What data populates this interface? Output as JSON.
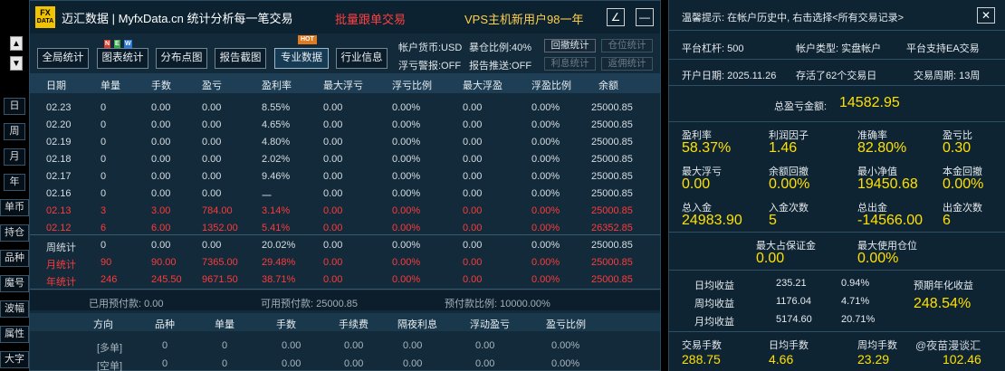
{
  "sidebar": {
    "up": "▲",
    "down": "▼",
    "periods": [
      "日",
      "周",
      "月",
      "年"
    ],
    "tools": [
      "单币",
      "持仓",
      "品种",
      "魔号",
      "波幅",
      "属性",
      "大字"
    ]
  },
  "header": {
    "logo_top": "FX",
    "logo_bottom": "DATA",
    "title": "迈汇数据 | MyfxData.cn  统计分析每一笔交易",
    "promo1": "批量跟单交易",
    "promo2": "VPS主机新用户98一年",
    "edit_icon": "∠",
    "min_icon": "—"
  },
  "toolbar": {
    "buttons": [
      "全局统计",
      "图表统计",
      "分布点图",
      "报告截图",
      "专业数据",
      "行业信息"
    ],
    "new_badge": "NEW",
    "hot_badge": "HOT",
    "info": {
      "currency": "帐户货币:USD",
      "exposure": "暴仓比例:40%",
      "float_alert": "浮亏警报:OFF",
      "report": "报告推送:OFF"
    },
    "small": [
      "回撤统计",
      "仓位统计",
      "利息统计",
      "返佣统计"
    ]
  },
  "grid": {
    "headers": [
      "日期",
      "单量",
      "手数",
      "盈亏",
      "盈利率",
      "最大浮亏",
      "浮亏比例",
      "最大浮盈",
      "浮盈比例",
      "余额"
    ],
    "rows": [
      {
        "c": [
          "02.23",
          "0",
          "0.00",
          "0.00",
          "8.55%",
          "0.00",
          "0.00%",
          "0.00",
          "0.00%",
          "25000.85"
        ],
        "red": false
      },
      {
        "c": [
          "02.20",
          "0",
          "0.00",
          "0.00",
          "4.65%",
          "0.00",
          "0.00%",
          "0.00",
          "0.00%",
          "25000.85"
        ],
        "red": false
      },
      {
        "c": [
          "02.19",
          "0",
          "0.00",
          "0.00",
          "4.80%",
          "0.00",
          "0.00%",
          "0.00",
          "0.00%",
          "25000.85"
        ],
        "red": false
      },
      {
        "c": [
          "02.18",
          "0",
          "0.00",
          "0.00",
          "2.02%",
          "0.00",
          "0.00%",
          "0.00",
          "0.00%",
          "25000.85"
        ],
        "red": false
      },
      {
        "c": [
          "02.17",
          "0",
          "0.00",
          "0.00",
          "9.46%",
          "0.00",
          "0.00%",
          "0.00",
          "0.00%",
          "25000.85"
        ],
        "red": false
      },
      {
        "c": [
          "02.16",
          "0",
          "0.00",
          "0.00",
          "一",
          "0.00",
          "0.00%",
          "0.00",
          "0.00%",
          "25000.85"
        ],
        "red": false
      },
      {
        "c": [
          "02.13",
          "3",
          "3.00",
          "784.00",
          "3.14%",
          "0.00",
          "0.00%",
          "0.00",
          "0.00%",
          "25000.85"
        ],
        "red": true
      },
      {
        "c": [
          "02.12",
          "6",
          "6.00",
          "1352.00",
          "5.41%",
          "0.00",
          "0.00%",
          "0.00",
          "0.00%",
          "26352.85"
        ],
        "red": true
      }
    ],
    "stats": [
      {
        "c": [
          "周统计",
          "0",
          "0.00",
          "0.00",
          "20.02%",
          "0.00",
          "0.00%",
          "0.00",
          "0.00%",
          "25000.85"
        ],
        "red": false
      },
      {
        "c": [
          "月统计",
          "90",
          "90.00",
          "7365.00",
          "29.48%",
          "0.00",
          "0.00%",
          "0.00",
          "0.00%",
          "25000.85"
        ],
        "red": true
      },
      {
        "c": [
          "年统计",
          "246",
          "245.50",
          "9671.50",
          "38.71%",
          "0.00",
          "0.00%",
          "0.00",
          "0.00%",
          "25000.85"
        ],
        "red": true
      }
    ],
    "summary": [
      "已用预付款: 0.00",
      "可用预付款: 25000.85",
      "预付款比例: 10000.00%"
    ]
  },
  "positions": {
    "headers": [
      "方向",
      "品种",
      "单量",
      "手数",
      "手续费",
      "隔夜利息",
      "浮动盈亏",
      "盈亏比例"
    ],
    "rows": [
      [
        "[多单]",
        "0",
        "0",
        "0.00",
        "0.00",
        "0.00",
        "0.00",
        "0.00%"
      ],
      [
        "[空单]",
        "0",
        "0",
        "0.00",
        "0.00",
        "0.00",
        "0.00",
        "0.00%"
      ]
    ]
  },
  "right": {
    "notice": "温馨提示: 在帐户历史中, 右击选择<所有交易记录>",
    "close_icon": "✕",
    "leverage": "平台杠杆: 500",
    "acct_type": "帐户类型: 实盘帐户",
    "ea": "平台支持EA交易",
    "open_date": "开户日期: 2025.11.26",
    "days": "存活了62个交易日",
    "period": "交易周期: 13周",
    "total_label": "总盈亏金额:",
    "total_value": "14582.95",
    "metrics": [
      {
        "l": "盈利率",
        "v": "58.37%"
      },
      {
        "l": "利润因子",
        "v": "1.46"
      },
      {
        "l": "准确率",
        "v": "82.80%"
      },
      {
        "l": "盈亏比",
        "v": "0.30"
      },
      {
        "l": "最大浮亏",
        "v": "0.00"
      },
      {
        "l": "余额回撤",
        "v": "0.00%"
      },
      {
        "l": "最小净值",
        "v": "19450.68"
      },
      {
        "l": "本金回撤",
        "v": "0.00%"
      },
      {
        "l": "总入金",
        "v": "24983.90"
      },
      {
        "l": "入金次数",
        "v": "5"
      },
      {
        "l": "总出金",
        "v": "-14566.00"
      },
      {
        "l": "出金次数",
        "v": "6"
      }
    ],
    "margin": [
      {
        "l": "最大占保证金",
        "v": "0.00"
      },
      {
        "l": "最大使用仓位",
        "v": "0.00%"
      }
    ],
    "income": [
      [
        "日均收益",
        "235.21",
        "0.94%"
      ],
      [
        "周均收益",
        "1176.04",
        "4.71%"
      ],
      [
        "月均收益",
        "5174.60",
        "20.71%"
      ]
    ],
    "annual_label": "预期年化收益",
    "annual_value": "248.54%",
    "bottom": [
      {
        "l": "交易手数",
        "v": "288.75"
      },
      {
        "l": "日均手数",
        "v": "4.66"
      },
      {
        "l": "周均手数",
        "v": "23.29"
      },
      {
        "l": "",
        "v": "102.46"
      }
    ],
    "watermark": "@夜苗漫谈汇"
  }
}
